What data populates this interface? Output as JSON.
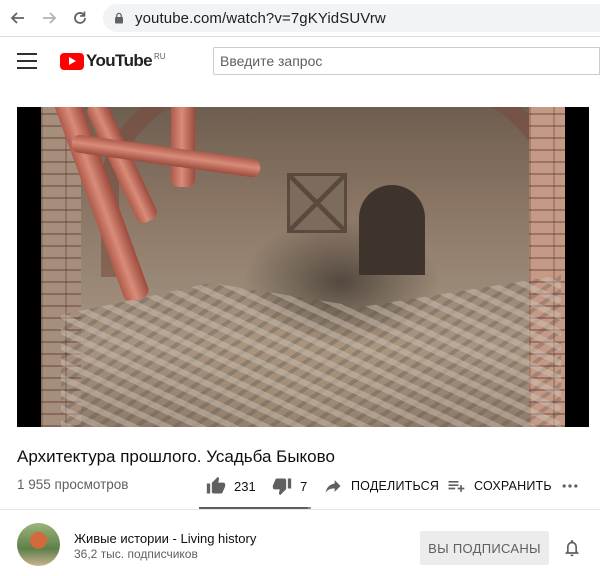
{
  "browser": {
    "url": "youtube.com/watch?v=7gKYidSUVrw"
  },
  "header": {
    "logo_text": "YouTube",
    "logo_region": "RU",
    "search_placeholder": "Введите запрос"
  },
  "video": {
    "title": "Архитектура прошлого. Усадьба Быково",
    "views": "1 955 просмотров",
    "likes": "231",
    "dislikes": "7",
    "like_ratio": 0.97,
    "share_label": "ПОДЕЛИТЬСЯ",
    "save_label": "СОХРАНИТЬ"
  },
  "channel": {
    "name": "Живые истории - Living history",
    "subscribers": "36,2 тыс. подписчиков",
    "subscribe_label": "ВЫ ПОДПИСАНЫ"
  },
  "colors": {
    "brand": "#ff0000",
    "text_primary": "#0f0f0f",
    "text_secondary": "#606060",
    "subscribed_bg": "#ececec"
  },
  "icons": [
    "back-arrow-icon",
    "forward-arrow-icon",
    "reload-icon",
    "lock-icon",
    "menu-icon",
    "youtube-logo-icon",
    "thumb-up-icon",
    "thumb-down-icon",
    "share-icon",
    "playlist-add-icon",
    "more-icon",
    "bell-icon"
  ]
}
